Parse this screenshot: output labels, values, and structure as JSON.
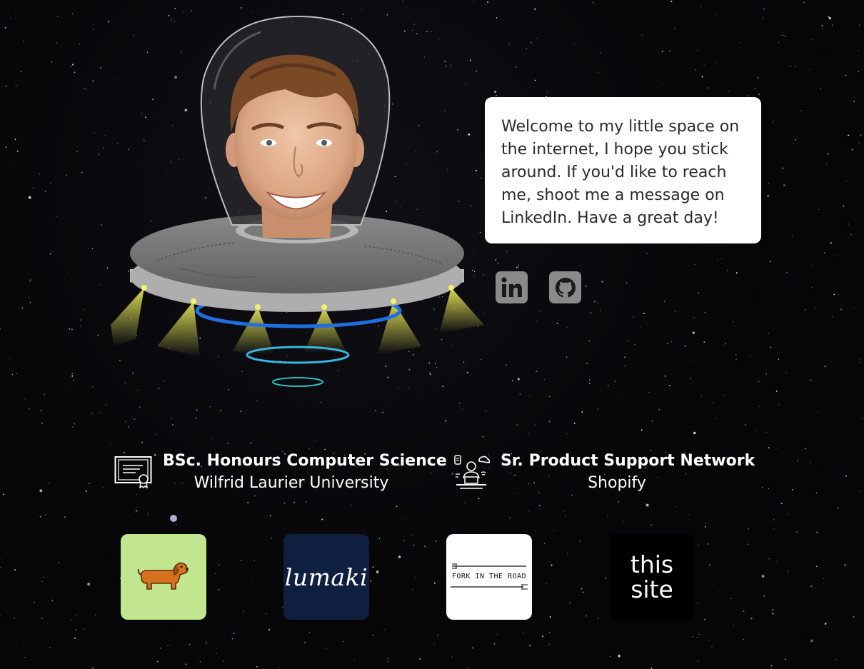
{
  "welcome": {
    "message": "Welcome to my little space on the internet, I hope you stick around. If you'd like to reach me, shoot me a message on LinkedIn. Have a great day!"
  },
  "social": [
    {
      "name": "LinkedIn",
      "icon": "linkedin-icon"
    },
    {
      "name": "GitHub",
      "icon": "github-icon"
    }
  ],
  "education": {
    "title": "BSc. Honours Computer Science",
    "institution": "Wilfrid Laurier University",
    "icon": "certificate-icon"
  },
  "work": {
    "title": "Sr. Product Support Network",
    "company": "Shopify",
    "icon": "remote-worker-icon"
  },
  "projects": [
    {
      "name": "dachshund project",
      "icon": "dachshund-icon",
      "color": "#c2e68f"
    },
    {
      "name": "lumaki",
      "label": "lumaki",
      "color": "#0e1f3f"
    },
    {
      "name": "Fork in the Road",
      "label": "FORK IN THE ROAD",
      "color": "#ffffff"
    },
    {
      "name": "this site",
      "label_line1": "this",
      "label_line2": "site",
      "color": "#000000"
    }
  ],
  "colors": {
    "background": "#060608",
    "bubble": "#ffffff",
    "social_button": "#8a8a8a",
    "ufo_ring": "#1e6fe0",
    "ufo_light": "#e8e85a"
  }
}
